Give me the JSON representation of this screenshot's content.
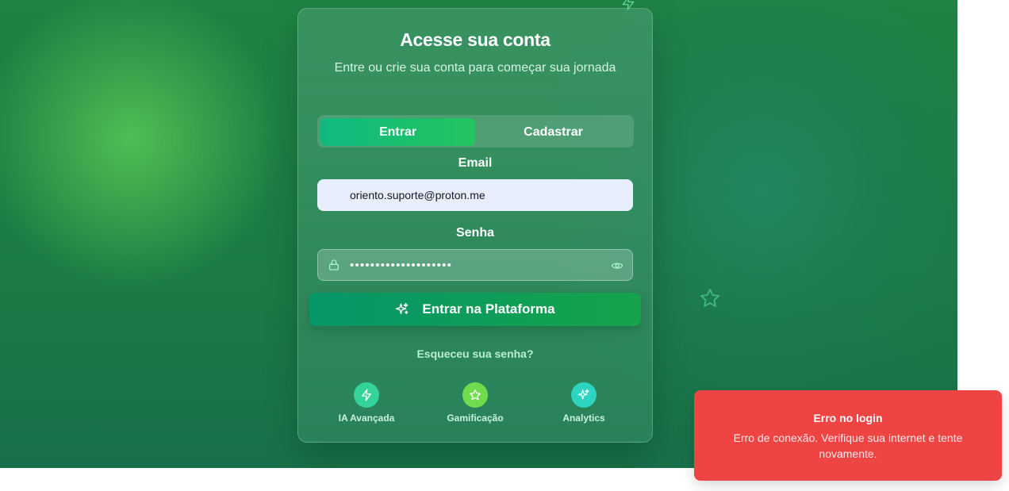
{
  "login": {
    "title": "Acesse sua conta",
    "subtitle": "Entre ou crie sua conta para começar sua jornada",
    "tabs": [
      {
        "label": "Entrar",
        "active": true
      },
      {
        "label": "Cadastrar",
        "active": false
      }
    ],
    "email": {
      "label": "Email",
      "value": "oriento.suporte@proton.me"
    },
    "password": {
      "label": "Senha",
      "masked_value": "••••••••••••••••••••"
    },
    "submit_label": "Entrar na Plataforma",
    "forgot_label": "Esqueceu sua senha?",
    "features": [
      {
        "label": "IA Avançada",
        "icon": "lightning-icon",
        "color": "#34d399"
      },
      {
        "label": "Gamificação",
        "icon": "star-icon",
        "color": "#6fdc4e"
      },
      {
        "label": "Analytics",
        "icon": "sparkles-icon",
        "color": "#2dd4bf"
      }
    ]
  },
  "background_icons": [
    "lightning-icon",
    "star-icon"
  ],
  "toast": {
    "title": "Erro no login",
    "message": "Erro de conexão. Verifique sua internet e tente novamente.",
    "color": "#ef4444"
  },
  "colors": {
    "accent": "#10b981",
    "brand_green": "#16a34a",
    "error": "#ef4444"
  }
}
